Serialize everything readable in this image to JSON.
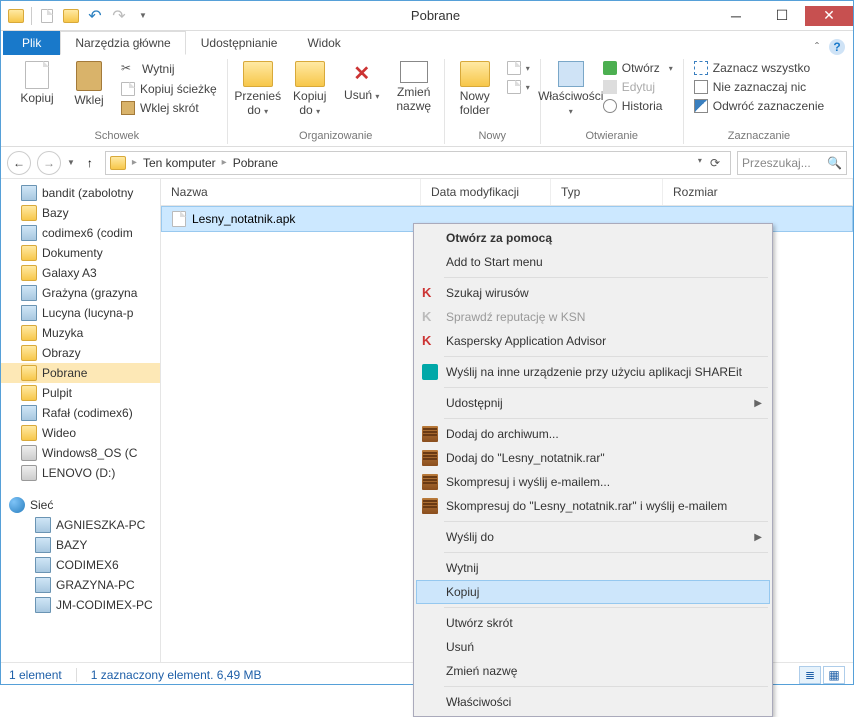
{
  "window": {
    "title": "Pobrane"
  },
  "tabs": {
    "file": "Plik",
    "home": "Narzędzia główne",
    "share": "Udostępnianie",
    "view": "Widok"
  },
  "ribbon": {
    "clipboard": {
      "label": "Schowek",
      "copy": "Kopiuj",
      "paste": "Wklej",
      "cut": "Wytnij",
      "copypath": "Kopiuj ścieżkę",
      "pastelnk": "Wklej skrót"
    },
    "organize": {
      "label": "Organizowanie",
      "moveto": "Przenieś do",
      "copyto": "Kopiuj do",
      "delete": "Usuń",
      "rename": "Zmień nazwę"
    },
    "new": {
      "label": "Nowy",
      "newfolder": "Nowy folder"
    },
    "open": {
      "label": "Otwieranie",
      "props": "Właściwości",
      "open": "Otwórz",
      "edit": "Edytuj",
      "history": "Historia"
    },
    "select": {
      "label": "Zaznaczanie",
      "all": "Zaznacz wszystko",
      "none": "Nie zaznaczaj nic",
      "invert": "Odwróć zaznaczenie"
    }
  },
  "breadcrumb": {
    "pc": "Ten komputer",
    "folder": "Pobrane"
  },
  "search": {
    "placeholder": "Przeszukaj..."
  },
  "columns": {
    "name": "Nazwa",
    "date": "Data modyfikacji",
    "type": "Typ",
    "size": "Rozmiar"
  },
  "tree": [
    "bandit (zabolotny",
    "Bazy",
    "codimex6 (codim",
    "Dokumenty",
    "Galaxy A3",
    "Grażyna (grazyna",
    "Lucyna (lucyna-p",
    "Muzyka",
    "Obrazy",
    "Pobrane",
    "Pulpit",
    "Rafał (codimex6)",
    "Wideo",
    "Windows8_OS (C",
    "LENOVO (D:)"
  ],
  "tree_net": {
    "label": "Sieć",
    "items": [
      "AGNIESZKA-PC",
      "BAZY",
      "CODIMEX6",
      "GRAZYNA-PC",
      "JM-CODIMEX-PC"
    ]
  },
  "file": {
    "name": "Lesny_notatnik.apk"
  },
  "ctx": {
    "openwith": "Otwórz za pomocą",
    "addstart": "Add to Start menu",
    "scan": "Szukaj wirusów",
    "ksn": "Sprawdź reputację w KSN",
    "kaa": "Kaspersky Application Advisor",
    "shareit": "Wyślij na inne urządzenie przy użyciu aplikacji SHAREit",
    "sharewith": "Udostępnij",
    "addarch": "Dodaj do archiwum...",
    "addrar": "Dodaj do \"Lesny_notatnik.rar\"",
    "compmail": "Skompresuj i wyślij e-mailem...",
    "comprarmail": "Skompresuj do \"Lesny_notatnik.rar\" i wyślij e-mailem",
    "sendto": "Wyślij do",
    "cut": "Wytnij",
    "copy": "Kopiuj",
    "shortcut": "Utwórz skrót",
    "delete": "Usuń",
    "rename": "Zmień nazwę",
    "props": "Właściwości"
  },
  "status": {
    "count": "1 element",
    "selected": "1 zaznaczony element. 6,49 MB"
  }
}
